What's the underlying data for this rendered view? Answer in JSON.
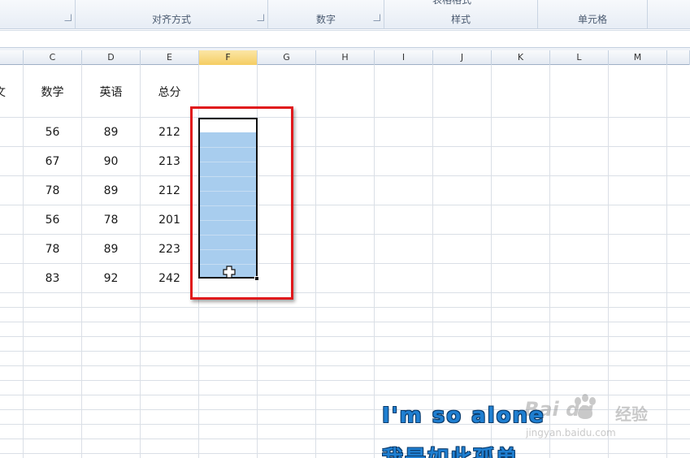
{
  "ribbon": {
    "groups": [
      {
        "label": "",
        "launcher": true
      },
      {
        "label": "对齐方式",
        "launcher": true
      },
      {
        "label": "数字",
        "launcher": true
      },
      {
        "label": "样式",
        "cut_label": "表格格式",
        "launcher": false
      },
      {
        "label": "单元格",
        "launcher": false
      }
    ]
  },
  "formula_bar": {
    "value": ""
  },
  "columns": [
    "C",
    "D",
    "E",
    "F",
    "G",
    "H",
    "I",
    "J",
    "K",
    "L",
    "M"
  ],
  "selected_column": "F",
  "sheet": {
    "partial_header": "文",
    "headers": {
      "C": "数学",
      "D": "英语",
      "E": "总分"
    },
    "rows": [
      {
        "C": "56",
        "D": "89",
        "E": "212"
      },
      {
        "C": "67",
        "D": "90",
        "E": "213"
      },
      {
        "C": "78",
        "D": "89",
        "E": "212"
      },
      {
        "C": "56",
        "D": "78",
        "E": "201"
      },
      {
        "C": "78",
        "D": "89",
        "E": "223"
      },
      {
        "C": "83",
        "D": "92",
        "E": "242"
      }
    ]
  },
  "selection": {
    "column": "F",
    "cursor_icon": "crosshair-plus-icon"
  },
  "annotation": {
    "color": "#e0191c"
  },
  "overlay": {
    "line1": "I'm so alone",
    "line2": "我是如此孤单"
  },
  "watermark": {
    "brand": "Bai  du",
    "cn": "经验",
    "url": "jingyan.baidu.com",
    "icon": "baidu-paw-icon"
  },
  "colors": {
    "selection_fill": "#a8cdee",
    "selected_header": "#f5cd63",
    "lyric_text": "#1f7fd1"
  }
}
